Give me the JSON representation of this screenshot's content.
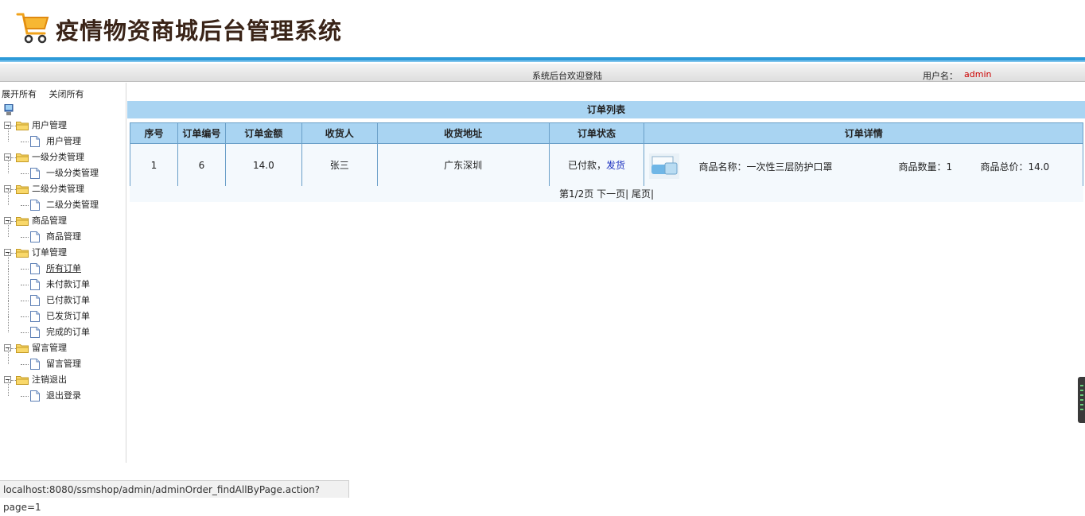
{
  "header": {
    "title": "疫情物资商城后台管理系统"
  },
  "welcome": {
    "text": "系统后台欢迎登陆",
    "user_label": "用户名：",
    "user_name": "admin"
  },
  "tree": {
    "expand_all": "展开所有",
    "collapse_all": "关闭所有",
    "groups": [
      {
        "label": "用户管理",
        "items": [
          "用户管理"
        ]
      },
      {
        "label": "一级分类管理",
        "items": [
          "一级分类管理"
        ]
      },
      {
        "label": "二级分类管理",
        "items": [
          "二级分类管理"
        ]
      },
      {
        "label": "商品管理",
        "items": [
          "商品管理"
        ]
      },
      {
        "label": "订单管理",
        "items": [
          "所有订单",
          "未付款订单",
          "已付款订单",
          "已发货订单",
          "完成的订单"
        ]
      },
      {
        "label": "留言管理",
        "items": [
          "留言管理"
        ]
      },
      {
        "label": "注销退出",
        "items": [
          "退出登录"
        ]
      }
    ]
  },
  "orders": {
    "title": "订单列表",
    "columns": [
      "序号",
      "订单编号",
      "订单金额",
      "收货人",
      "收货地址",
      "订单状态",
      "订单详情"
    ],
    "rows": [
      {
        "index": "1",
        "order_no": "6",
        "amount": "14.0",
        "receiver": "张三",
        "address": "广东深圳",
        "status": "已付款，",
        "status_action": "发货",
        "detail": {
          "name": "商品名称：一次性三层防护口罩",
          "qty": "商品数量：1",
          "total": "商品总价：14.0"
        }
      }
    ],
    "pager": {
      "page_info": "第1/2页",
      "next": "下一页|",
      "last": "尾页|"
    }
  },
  "status_bar": {
    "url": "localhost:8080/ssmshop/admin/adminOrder_findAllByPage.action?page=1"
  },
  "colors": {
    "accent_blue": "#2d9ad8",
    "header_blue": "#a9d4f2",
    "user_red": "#cc0000",
    "link_blue": "#1a2fbf"
  }
}
